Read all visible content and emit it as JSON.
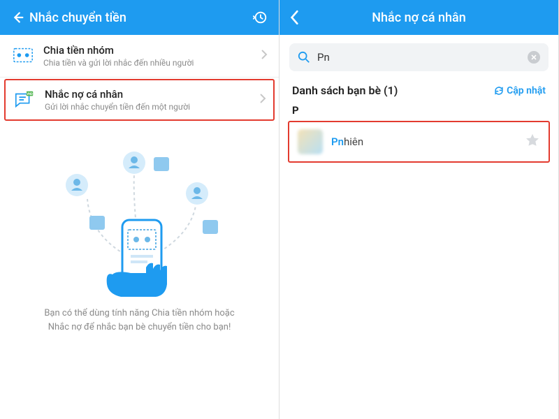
{
  "left": {
    "header": {
      "title": "Nhắc chuyển tiền"
    },
    "items": [
      {
        "title": "Chia tiền nhóm",
        "subtitle": "Chia tiền và gửi lời nhắc đến nhiều người"
      },
      {
        "title": "Nhắc nợ cá nhân",
        "subtitle": "Gửi lời nhắc chuyển tiền đến một người"
      }
    ],
    "hint": "Bạn có thể dùng tính năng Chia tiền nhóm hoặc Nhắc nợ để nhắc bạn bè chuyển tiền cho bạn!"
  },
  "right": {
    "header": {
      "title": "Nhắc nợ cá nhân"
    },
    "search": {
      "value": "Pn"
    },
    "section": {
      "title": "Danh sách bạn bè (1)",
      "refresh": "Cập nhật"
    },
    "letter": "P",
    "friend": {
      "match": "Pn",
      "rest": "hiên"
    }
  }
}
